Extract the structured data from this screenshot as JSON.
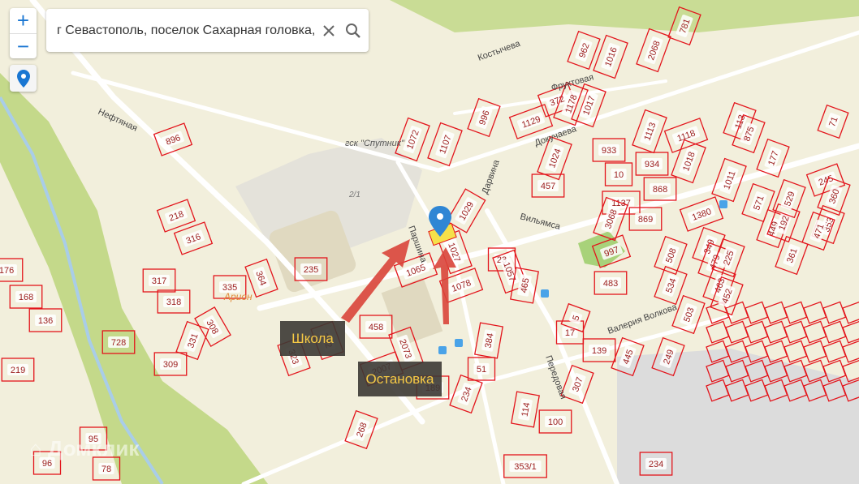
{
  "search": {
    "value": "г Севастополь, поселок Сахарная головка, ул Паршина",
    "clear_icon": "close-icon",
    "search_icon": "search-icon"
  },
  "controls": {
    "zoom_in": "+",
    "zoom_out": "−",
    "locate_icon": "map-pin-icon"
  },
  "callouts": {
    "school": "Школа",
    "stop": "Остановка"
  },
  "watermark": "Домклик",
  "colors": {
    "parcel": "#e3141b",
    "arrow": "#d9443a",
    "pin": "#2f86d4",
    "highlight": "#f5e04a",
    "green": "#c4d98a",
    "callout_text": "#f6c945"
  },
  "streets": [
    "Костычева",
    "Фруктовая",
    "Нефтяная",
    "Докучаева",
    "Дарвина",
    "Вильямса",
    "Паршина",
    "Валерия Волкова",
    "Передовая"
  ],
  "places": [
    "гск \"Спутник\"",
    "Арион",
    "2/1"
  ],
  "parcels": [
    "896",
    "218",
    "316",
    "317",
    "335",
    "364",
    "318",
    "308",
    "331",
    "309",
    "176",
    "168",
    "136",
    "219",
    "728",
    "323",
    "332",
    "235",
    "458",
    "2073",
    "2007",
    "189",
    "1065",
    "1027",
    "1078",
    "1029",
    "23",
    "1057",
    "465",
    "384",
    "51",
    "114",
    "100",
    "353/1",
    "234",
    "268",
    "95",
    "96",
    "78",
    "1072",
    "1107",
    "996",
    "1129",
    "372",
    "1178",
    "1017",
    "962",
    "1016",
    "2068",
    "781",
    "1024",
    "933",
    "934",
    "1113",
    "1118",
    "1018",
    "457",
    "10",
    "1137",
    "3068",
    "869",
    "868",
    "1380",
    "997",
    "483",
    "508",
    "534",
    "503",
    "139",
    "445",
    "249",
    "307",
    "17",
    "5",
    "349",
    "479",
    "225",
    "463",
    "452",
    "361",
    "449",
    "192",
    "353",
    "471",
    "245",
    "360",
    "571",
    "529",
    "1011",
    "113",
    "875",
    "177",
    "71",
    "234"
  ]
}
